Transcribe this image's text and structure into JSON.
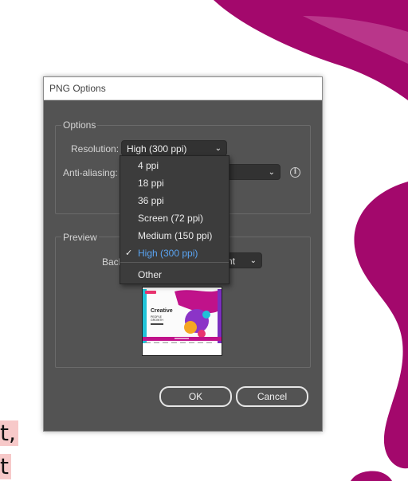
{
  "side_text": {
    "line1": "t,",
    "line2": "t"
  },
  "dialog": {
    "title": "PNG Options",
    "options_group": {
      "label": "Options",
      "resolution_label": "Resolution:",
      "resolution_value": "High (300 ppi)",
      "antialiasing_label": "Anti-aliasing:"
    },
    "resolution_menu": {
      "items": [
        "4 ppi",
        "18 ppi",
        "36 ppi",
        "Screen (72 ppi)",
        "Medium (150 ppi)",
        "High (300 ppi)",
        "Other"
      ],
      "checkmark": "✓"
    },
    "preview_group": {
      "label": "Preview",
      "background_label": "Back",
      "background_value": "nt"
    },
    "thumbnail": {
      "headline": "Creative",
      "sub1": "PEOPLE",
      "sub2": "GROWTH"
    },
    "ok_label": "OK",
    "cancel_label": "Cancel"
  },
  "colors": {
    "accent": "#5aa4f2",
    "brand": "#a3086c"
  }
}
